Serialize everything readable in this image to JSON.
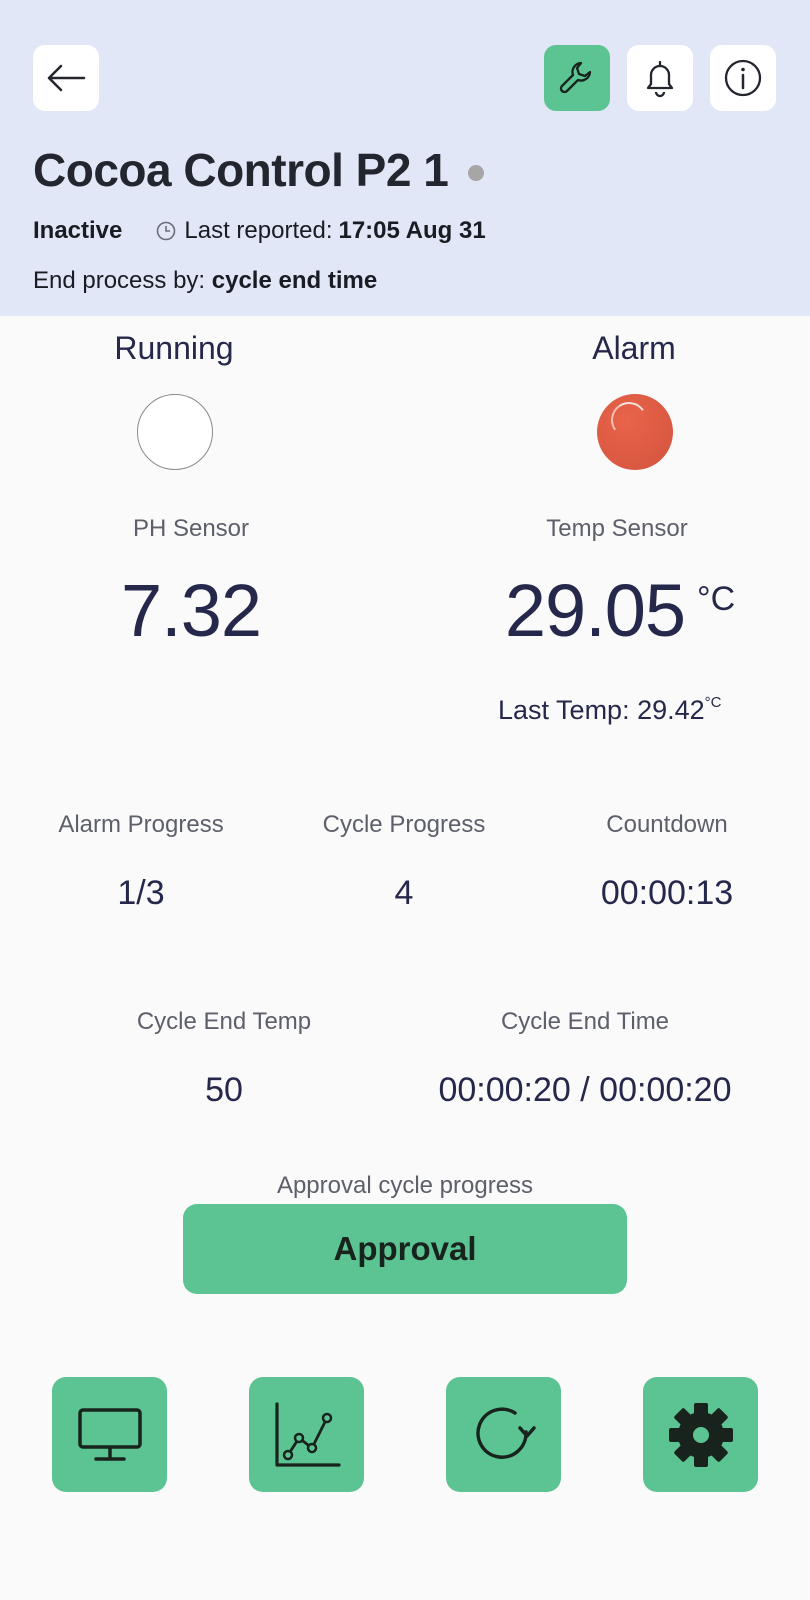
{
  "header": {
    "title": "Cocoa Control P2 1",
    "status": "Inactive",
    "last_reported_label": "Last reported:",
    "last_reported_time": "17:05 Aug 31",
    "end_process_label": "End process by:",
    "end_process_value": "cycle end time",
    "icons": [
      "back-arrow-icon",
      "wrench-icon",
      "bell-icon",
      "info-icon"
    ]
  },
  "indicators": {
    "running_label": "Running",
    "alarm_label": "Alarm"
  },
  "sensors": {
    "ph_label": "PH Sensor",
    "ph_value": "7.32",
    "temp_label": "Temp Sensor",
    "temp_value": "29.05",
    "temp_unit": "°C",
    "last_temp_label": "Last Temp: 29.42",
    "last_temp_unit": "°C"
  },
  "stats": {
    "alarm_progress_label": "Alarm Progress",
    "alarm_progress_value": "1/3",
    "cycle_progress_label": "Cycle Progress",
    "cycle_progress_value": "4",
    "countdown_label": "Countdown",
    "countdown_value": "00:00:13",
    "cycle_end_temp_label": "Cycle End Temp",
    "cycle_end_temp_value": "50",
    "cycle_end_time_label": "Cycle End Time",
    "cycle_end_time_value": "00:00:20 / 00:00:20"
  },
  "approval": {
    "label": "Approval cycle progress",
    "button": "Approval"
  },
  "bottom_nav": [
    "monitor-icon",
    "chart-icon",
    "refresh-icon",
    "gear-icon"
  ],
  "colors": {
    "header_bg": "#e1e7f6",
    "accent_green": "#5cc492",
    "alarm_red": "#dc5a43",
    "text_navy": "#25284b"
  }
}
